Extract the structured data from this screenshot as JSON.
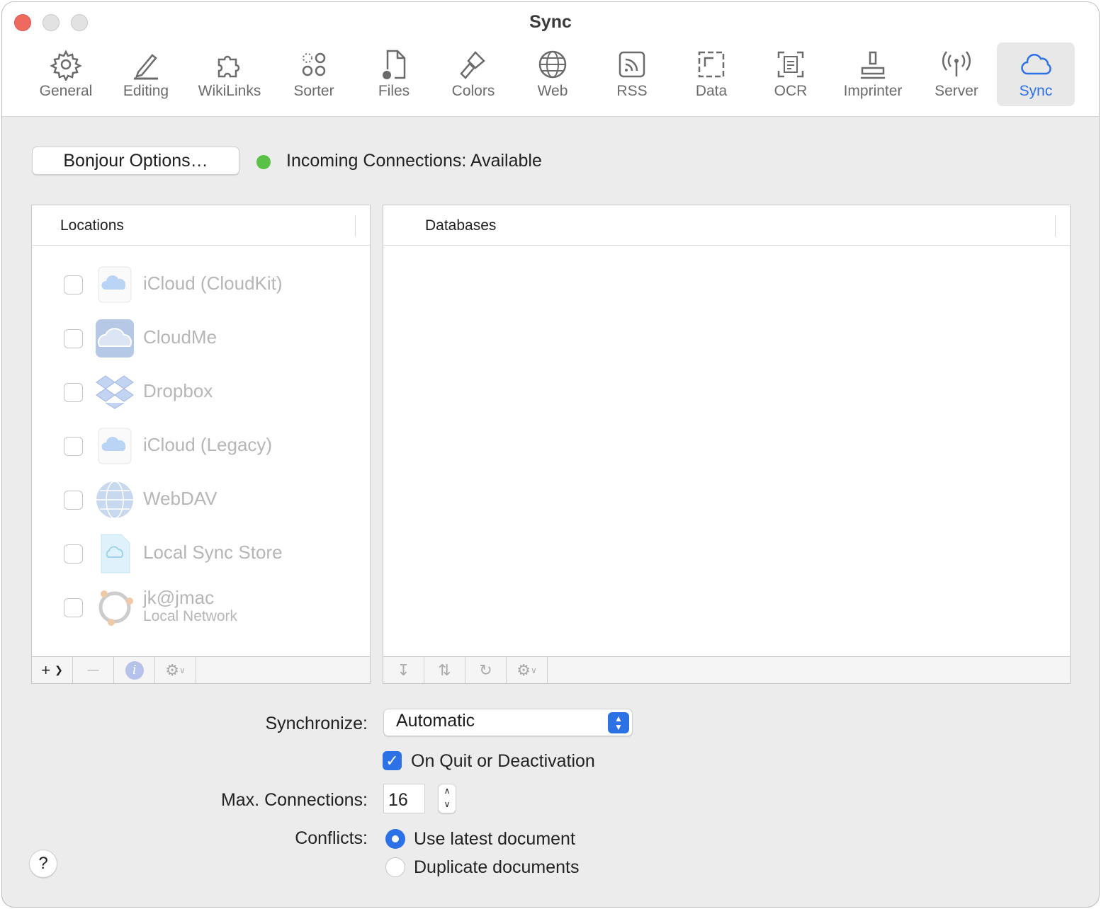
{
  "window": {
    "title": "Sync"
  },
  "toolbar": {
    "tabs": [
      {
        "label": "General",
        "icon": "gear-icon"
      },
      {
        "label": "Editing",
        "icon": "pencil-icon"
      },
      {
        "label": "WikiLinks",
        "icon": "puzzle-icon"
      },
      {
        "label": "Sorter",
        "icon": "circles-icon"
      },
      {
        "label": "Files",
        "icon": "file-gear-icon"
      },
      {
        "label": "Colors",
        "icon": "paintbrush-icon"
      },
      {
        "label": "Web",
        "icon": "globe-icon"
      },
      {
        "label": "RSS",
        "icon": "rss-icon"
      },
      {
        "label": "Data",
        "icon": "data-frame-icon"
      },
      {
        "label": "OCR",
        "icon": "ocr-icon"
      },
      {
        "label": "Imprinter",
        "icon": "stamp-icon"
      },
      {
        "label": "Server",
        "icon": "antenna-icon"
      },
      {
        "label": "Sync",
        "icon": "cloud-icon",
        "selected": true
      }
    ],
    "accent": "#2c72e6"
  },
  "bonjour_button": "Bonjour Options…",
  "status": {
    "text": "Incoming Connections: Available",
    "color": "#5ac146"
  },
  "locations": {
    "header": "Locations",
    "items": [
      {
        "name": "iCloud (CloudKit)",
        "checked": false
      },
      {
        "name": "CloudMe",
        "checked": false
      },
      {
        "name": "Dropbox",
        "checked": false
      },
      {
        "name": "iCloud (Legacy)",
        "checked": false
      },
      {
        "name": "WebDAV",
        "checked": false
      },
      {
        "name": "Local Sync Store",
        "checked": false
      },
      {
        "name": "jk@jmac",
        "sub": "Local Network",
        "checked": false
      }
    ],
    "bar": {
      "add": "+",
      "remove": "—"
    }
  },
  "databases": {
    "header": "Databases"
  },
  "form": {
    "synchronize_label": "Synchronize:",
    "synchronize_value": "Automatic",
    "on_quit_label": "On Quit or Deactivation",
    "on_quit_checked": true,
    "max_label": "Max. Connections:",
    "max_value": "16",
    "conflicts_label": "Conflicts:",
    "conflict_options": [
      {
        "label": "Use latest document",
        "selected": true
      },
      {
        "label": "Duplicate documents",
        "selected": false
      }
    ]
  },
  "help": "?"
}
